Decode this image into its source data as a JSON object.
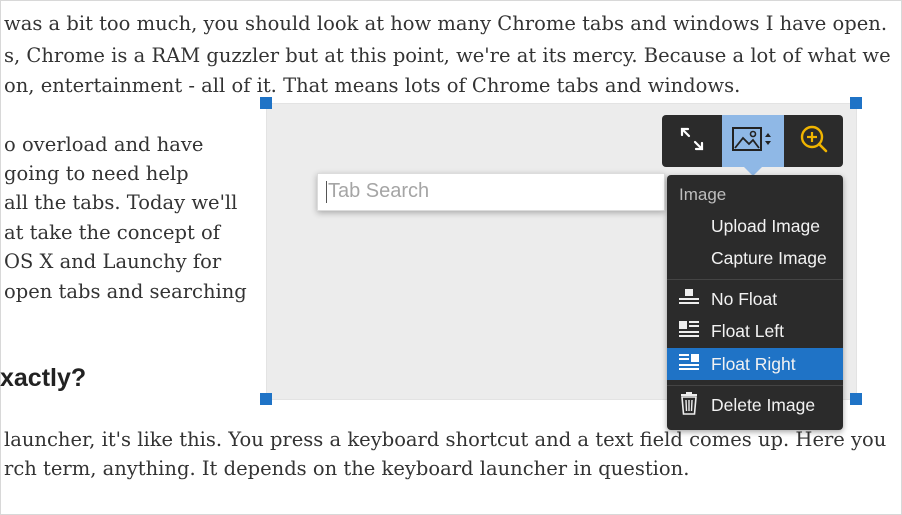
{
  "article": {
    "lines": [
      "was a bit too much, you should look at how many Chrome tabs and windows I have open.",
      "s, Chrome is a RAM guzzler but at this point, we're at its mercy. Because a lot of what we",
      "on, entertainment - all of it. That means lots of Chrome tabs and windows.",
      "o overload and have",
      "going to need help",
      "all the tabs. Today we'll",
      "at take the concept of",
      "OS X and Launchy for",
      "open tabs and searching"
    ],
    "heading": "xactly?",
    "bottom_lines": [
      "launcher, it's like this. You press a keyboard shortcut and a text field comes up. Here you",
      "rch term, anything. It depends on the keyboard launcher in question."
    ]
  },
  "image": {
    "search_placeholder": "Tab Search"
  },
  "toolbar": {
    "buttons": [
      {
        "icon": "expand-arrows-icon"
      },
      {
        "icon": "image-dropdown-icon",
        "active": true
      },
      {
        "icon": "zoom-in-icon"
      }
    ],
    "colors": {
      "bg": "#2b2b2b",
      "active": "#8fb8e6",
      "accent": "#f0b400"
    }
  },
  "menu": {
    "title": "Image",
    "items": [
      {
        "label": "Upload Image"
      },
      {
        "label": "Capture Image"
      },
      {
        "label": "No Float",
        "icon": "no-float-icon"
      },
      {
        "label": "Float Left",
        "icon": "float-left-icon"
      },
      {
        "label": "Float Right",
        "icon": "float-right-icon",
        "selected": true
      },
      {
        "label": "Delete Image",
        "icon": "trash-icon"
      }
    ],
    "colors": {
      "selected": "#1f73c6"
    }
  }
}
